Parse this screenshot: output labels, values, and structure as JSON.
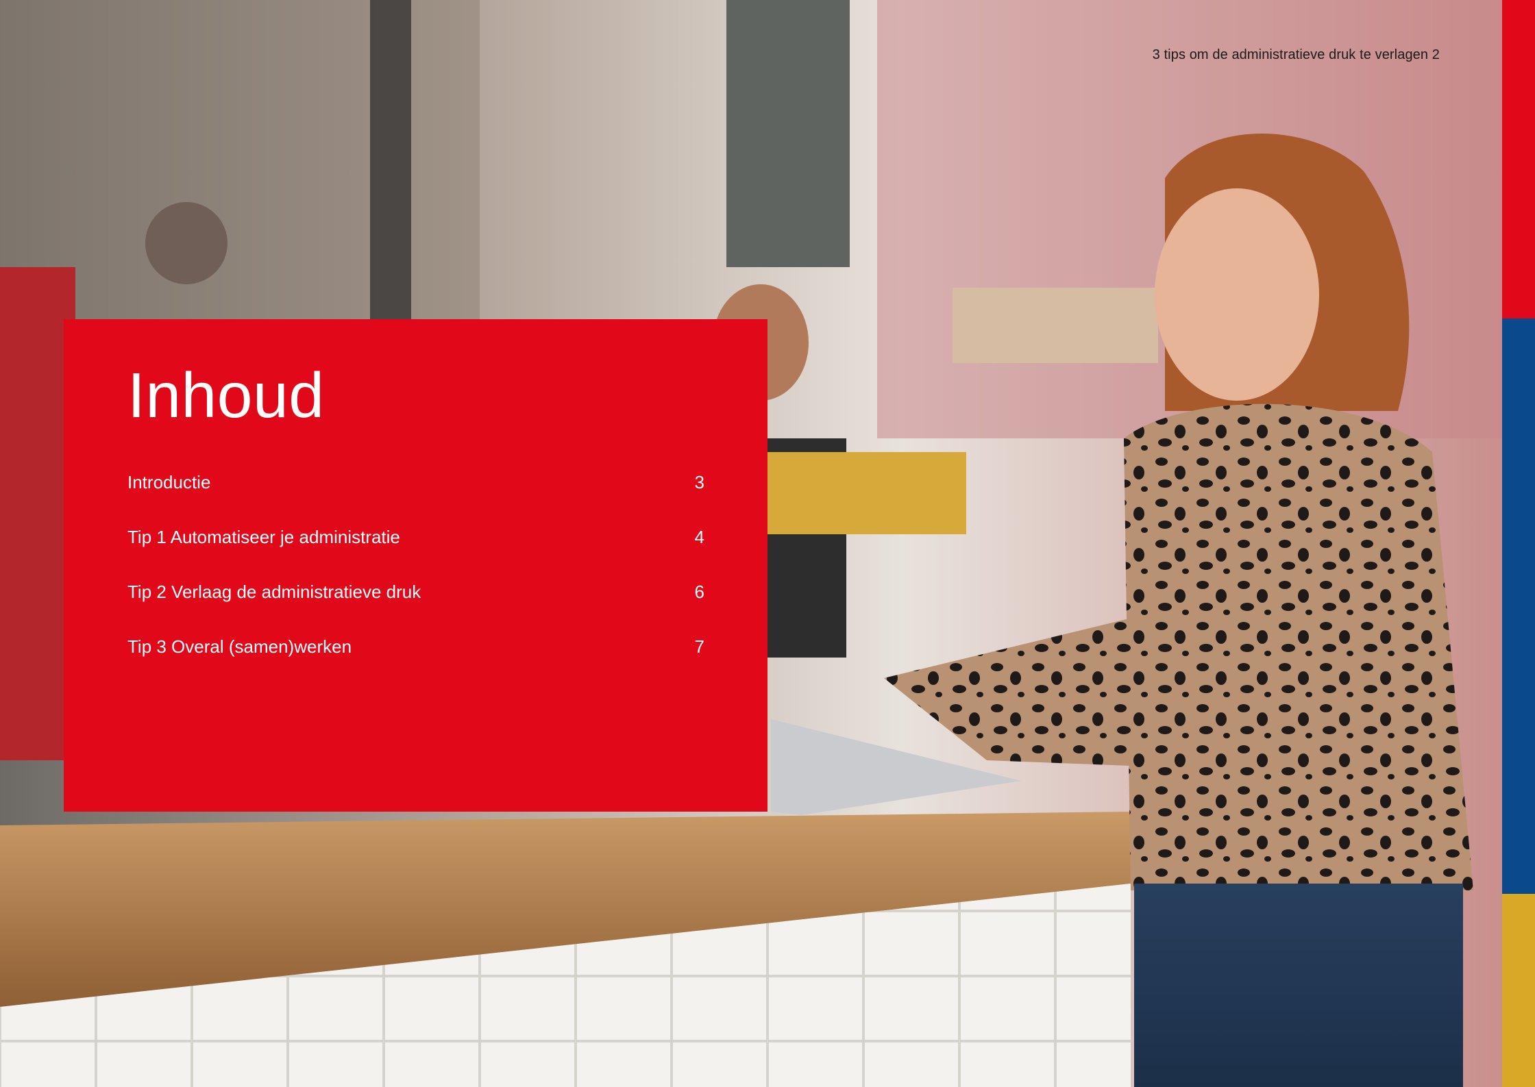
{
  "header": {
    "document_title": "3 tips om de administratieve druk te verlagen 2"
  },
  "toc": {
    "title": "Inhoud",
    "items": [
      {
        "label": "Introductie",
        "page": "3"
      },
      {
        "label": "Tip 1 Automatiseer je administratie",
        "page": "4"
      },
      {
        "label": "Tip 2 Verlaag de administratieve druk",
        "page": "6"
      },
      {
        "label": "Tip 3 Overal (samen)werken",
        "page": "7"
      }
    ]
  },
  "colors": {
    "panel": "#e1081a",
    "stripe_red": "#e1081a",
    "stripe_blue": "#0a4a8c",
    "stripe_yellow": "#d9a826"
  },
  "image": {
    "description_icon": "photo-woman-laptop-pizzeria"
  }
}
